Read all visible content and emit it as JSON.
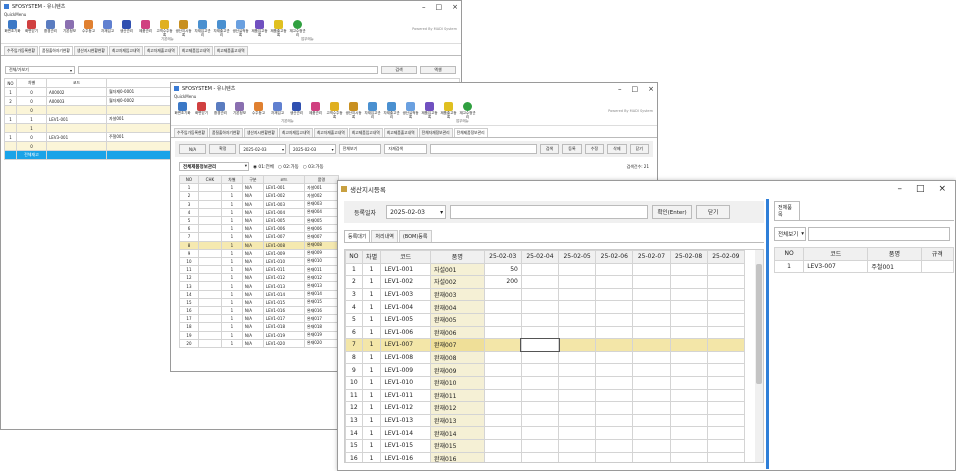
{
  "win1": {
    "title": "SFOSYSTEM - 유니텐츠",
    "quickmenu": "QuickMenu",
    "tabs": [
      "수주입가등록현황",
      "품질출하자기현황",
      "생산지시현황현황",
      "최고자재입고내역",
      "최고자재출고내역",
      "최고제품입고내역",
      "최고제품출고내역"
    ],
    "filter": "전체/가보기",
    "btn_search": "검색",
    "btn_excel": "엑셀",
    "headers": [
      "NO",
      "차별",
      "코드"
    ],
    "rows": [
      [
        "1",
        "0",
        "A00002",
        "월자재0-0001"
      ],
      [
        "2",
        "0",
        "A00003",
        "월자재0-0002"
      ],
      [
        "",
        "0",
        "",
        ""
      ],
      [
        "1",
        "1",
        "LEV1-001",
        "자설001"
      ],
      [
        "",
        "1",
        "",
        ""
      ],
      [
        "1",
        "0",
        "LEV3-001",
        "주철001"
      ],
      [
        "",
        "0",
        "",
        ""
      ],
      [
        "",
        "전체재고",
        "",
        ""
      ]
    ]
  },
  "win2": {
    "title": "SFOSYSTEM - 유니텐츠",
    "quickmenu": "QuickMenu",
    "ribbon": [
      "화면초기화",
      "화면닫기",
      "환경관리",
      "기본정보",
      "수주등고",
      "자재입고",
      "생산관리",
      "제품관리",
      "고객수주등록",
      "생산지시등록",
      "자재입고관리",
      "자재출고관리",
      "생산실적등록",
      "제품입고등록",
      "제품출고등록",
      "재고수정관리"
    ],
    "powered": "Powered By MADI System",
    "group1": "기본메뉴",
    "group2": "업무메뉴",
    "tabs": [
      "수주입가등록현황",
      "품질출하자기현황",
      "생산지시현황현황",
      "최고자재입고내역",
      "최고자재출고내역",
      "최고제품입고내역",
      "최고제품출고내역",
      "전체자재정보관리",
      "전체제품정보관리"
    ],
    "btn_na": "N/A",
    "btn_confirm": "확정",
    "date_from": "2025-02-03",
    "date_to": "2025-02-03",
    "view_sel": "전체보기",
    "type_sel": "자재검색",
    "btn_search": "검색",
    "btn_reg": "등록",
    "btn_edit": "수정",
    "btn_del": "삭제",
    "btn_close": "닫기",
    "section_title": "전체제품정보관리",
    "radios": [
      "01:전체",
      "02:가동",
      "03:가동"
    ],
    "count": "검색건수: 21",
    "headers": [
      "NO",
      "CHK",
      "차별",
      "구분",
      "코드",
      "품명"
    ],
    "rows": [
      [
        "1",
        "",
        "1",
        "N/A",
        "LEV1-001",
        "자설001"
      ],
      [
        "2",
        "",
        "1",
        "N/A",
        "LEV1-002",
        "자설002"
      ],
      [
        "3",
        "",
        "1",
        "N/A",
        "LEV1-003",
        "완재003"
      ],
      [
        "4",
        "",
        "1",
        "N/A",
        "LEV1-004",
        "완재004"
      ],
      [
        "5",
        "",
        "1",
        "N/A",
        "LEV1-005",
        "완재005"
      ],
      [
        "6",
        "",
        "1",
        "N/A",
        "LEV1-006",
        "완재006"
      ],
      [
        "7",
        "",
        "1",
        "N/A",
        "LEV1-007",
        "완재007"
      ],
      [
        "8",
        "",
        "1",
        "N/A",
        "LEV1-008",
        "완재008"
      ],
      [
        "9",
        "",
        "1",
        "N/A",
        "LEV1-009",
        "완재009"
      ],
      [
        "10",
        "",
        "1",
        "N/A",
        "LEV1-010",
        "완재010"
      ],
      [
        "11",
        "",
        "1",
        "N/A",
        "LEV1-011",
        "완재011"
      ],
      [
        "12",
        "",
        "1",
        "N/A",
        "LEV1-012",
        "완재012"
      ],
      [
        "13",
        "",
        "1",
        "N/A",
        "LEV1-013",
        "완재013"
      ],
      [
        "14",
        "",
        "1",
        "N/A",
        "LEV1-014",
        "완재014"
      ],
      [
        "15",
        "",
        "1",
        "N/A",
        "LEV1-015",
        "완재015"
      ],
      [
        "16",
        "",
        "1",
        "N/A",
        "LEV1-016",
        "완재016"
      ],
      [
        "17",
        "",
        "1",
        "N/A",
        "LEV1-017",
        "완재017"
      ],
      [
        "18",
        "",
        "1",
        "N/A",
        "LEV1-018",
        "완재018"
      ],
      [
        "19",
        "",
        "1",
        "N/A",
        "LEV1-019",
        "완재019"
      ],
      [
        "20",
        "",
        "1",
        "N/A",
        "LEV1-020",
        "완재020"
      ]
    ]
  },
  "win3": {
    "title": "생산지시등록",
    "date_label": "등록일자",
    "date": "2025-02-03",
    "btn_confirm": "확인(Enter)",
    "btn_close": "닫기",
    "tabs": [
      "등록대기",
      "처리내역",
      "(BOM)등록"
    ],
    "headers": [
      "NO",
      "차별",
      "코드",
      "품명",
      "25-02-03",
      "25-02-04",
      "25-02-05",
      "25-02-06",
      "25-02-07",
      "25-02-08",
      "25-02-09"
    ],
    "rows": [
      [
        "1",
        "1",
        "LEV1-001",
        "자설001",
        "50"
      ],
      [
        "2",
        "1",
        "LEV1-002",
        "자설002",
        "200"
      ],
      [
        "3",
        "1",
        "LEV1-003",
        "완재003",
        ""
      ],
      [
        "4",
        "1",
        "LEV1-004",
        "완재004",
        ""
      ],
      [
        "5",
        "1",
        "LEV1-005",
        "완재005",
        ""
      ],
      [
        "6",
        "1",
        "LEV1-006",
        "완재006",
        ""
      ],
      [
        "7",
        "1",
        "LEV1-007",
        "완재007",
        ""
      ],
      [
        "8",
        "1",
        "LEV1-008",
        "완재008",
        ""
      ],
      [
        "9",
        "1",
        "LEV1-009",
        "완재009",
        ""
      ],
      [
        "10",
        "1",
        "LEV1-010",
        "완재010",
        ""
      ],
      [
        "11",
        "1",
        "LEV1-011",
        "완재011",
        ""
      ],
      [
        "12",
        "1",
        "LEV1-012",
        "완재012",
        ""
      ],
      [
        "13",
        "1",
        "LEV1-013",
        "완재013",
        ""
      ],
      [
        "14",
        "1",
        "LEV1-014",
        "완재014",
        ""
      ],
      [
        "15",
        "1",
        "LEV1-015",
        "완재015",
        ""
      ],
      [
        "16",
        "1",
        "LEV1-016",
        "완재016",
        ""
      ],
      [
        "17",
        "1",
        "LEV1-017",
        "완재017",
        ""
      ]
    ],
    "selected_row": 6,
    "right_tab": "전체품목",
    "right_filter": "전체보기",
    "right_headers": [
      "NO",
      "코드",
      "품명",
      "규격"
    ],
    "right_rows": [
      [
        "1",
        "LEV3-007",
        "주철001",
        ""
      ]
    ]
  },
  "colors": {
    "selected_row": "#f3e6a8",
    "name_cell": "#f5f0d5",
    "accent_blue": "#2f7fd8",
    "cyan_row": "#1aa3e8"
  }
}
